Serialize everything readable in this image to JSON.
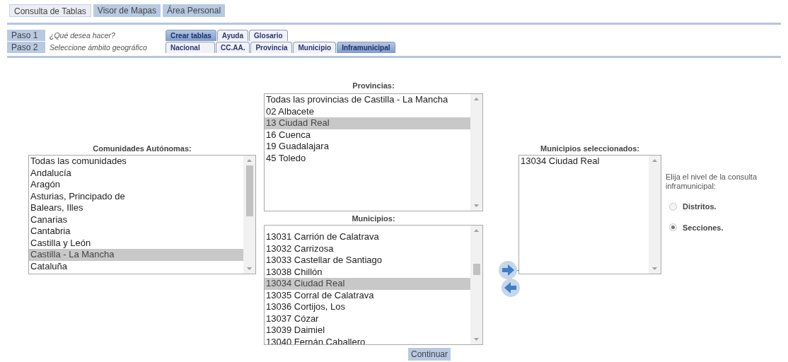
{
  "top_nav": [
    {
      "label": "Consulta de Tablas",
      "selected": true
    },
    {
      "label": "Visor de Mapas",
      "selected": false
    },
    {
      "label": "Área Personal",
      "selected": false
    }
  ],
  "steps": [
    {
      "label": "Paso 1",
      "description": "¿Qué desea hacer?",
      "tabs": [
        {
          "label": "Crear tablas",
          "selected": true
        },
        {
          "label": "Ayuda",
          "selected": false
        },
        {
          "label": "Glosario",
          "selected": false
        }
      ]
    },
    {
      "label": "Paso 2",
      "description": "Seleccione ámbito geográfico",
      "tabs": [
        {
          "label": "Nacional",
          "selected": false
        },
        {
          "label": "CC.AA.",
          "selected": false
        },
        {
          "label": "Provincia",
          "selected": false
        },
        {
          "label": "Municipio",
          "selected": false
        },
        {
          "label": "Inframunicipal",
          "selected": true
        }
      ]
    }
  ],
  "comunidades": {
    "title": "Comunidades Autónomas:",
    "items": [
      {
        "label": "Todas las comunidades",
        "selected": false
      },
      {
        "label": "Andalucía",
        "selected": false
      },
      {
        "label": "Aragón",
        "selected": false
      },
      {
        "label": "Asturias, Principado de",
        "selected": false
      },
      {
        "label": "Balears, Illes",
        "selected": false
      },
      {
        "label": "Canarias",
        "selected": false
      },
      {
        "label": "Cantabria",
        "selected": false
      },
      {
        "label": "Castilla y León",
        "selected": false
      },
      {
        "label": "Castilla - La Mancha",
        "selected": true
      },
      {
        "label": "Cataluña",
        "selected": false
      }
    ]
  },
  "provincias": {
    "title": "Provincias:",
    "items": [
      {
        "label": "Todas las provincias de Castilla - La Mancha",
        "selected": false
      },
      {
        "label": "02 Albacete",
        "selected": false
      },
      {
        "label": "13 Ciudad Real",
        "selected": true
      },
      {
        "label": "16 Cuenca",
        "selected": false
      },
      {
        "label": "19 Guadalajara",
        "selected": false
      },
      {
        "label": "45 Toledo",
        "selected": false
      }
    ]
  },
  "municipios": {
    "title": "Municipios:",
    "items": [
      {
        "label": "13031 Carrión de Calatrava",
        "selected": false
      },
      {
        "label": "13032 Carrizosa",
        "selected": false
      },
      {
        "label": "13033 Castellar de Santiago",
        "selected": false
      },
      {
        "label": "13038 Chillón",
        "selected": false
      },
      {
        "label": "13034 Ciudad Real",
        "selected": true
      },
      {
        "label": "13035 Corral de Calatrava",
        "selected": false
      },
      {
        "label": "13036 Cortijos, Los",
        "selected": false
      },
      {
        "label": "13037 Cózar",
        "selected": false
      },
      {
        "label": "13039 Daimiel",
        "selected": false
      },
      {
        "label": "13040 Fernán Caballero",
        "selected": false
      }
    ]
  },
  "arrow_dash": "-",
  "seleccionados": {
    "title": "Municipios seleccionados:",
    "items": [
      {
        "label": "13034 Ciudad Real",
        "selected": false
      }
    ]
  },
  "nivel": {
    "prompt": "Elija el nivel de la consulta inframunicipal:",
    "options": [
      {
        "label": "Distritos.",
        "selected": false
      },
      {
        "label": "Secciones.",
        "selected": true
      }
    ]
  },
  "continue_button": "Continuar"
}
